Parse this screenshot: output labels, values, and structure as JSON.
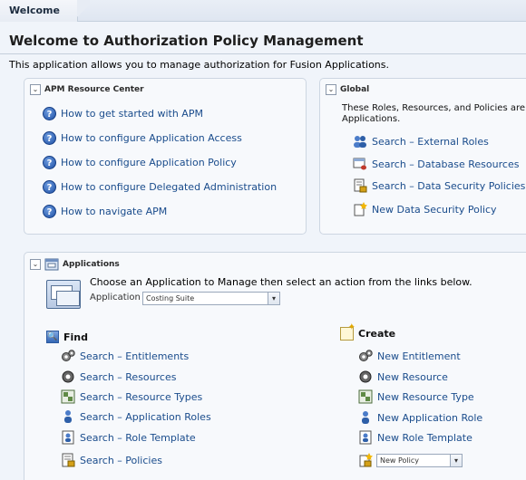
{
  "tab": {
    "label": "Welcome"
  },
  "page": {
    "title": "Welcome to Authorization Policy Management",
    "intro": "This application allows you to manage authorization for Fusion Applications."
  },
  "resource_center": {
    "title": "APM Resource Center",
    "links": [
      "How to get started with APM",
      "How to configure Application Access",
      "How to configure Application Policy",
      "How to configure Delegated Administration",
      "How to navigate APM"
    ]
  },
  "global": {
    "title": "Global",
    "description_line1": "These Roles, Resources, and Policies are s",
    "description_line2": "Applications.",
    "links": [
      {
        "label": "Search – External Roles",
        "icon": "external-roles-icon"
      },
      {
        "label": "Search – Database Resources",
        "icon": "database-resources-icon"
      },
      {
        "label": "Search – Data Security Policies",
        "icon": "data-security-policies-icon"
      },
      {
        "label": "New Data Security Policy",
        "icon": "new-data-security-policy-icon"
      }
    ]
  },
  "applications": {
    "title": "Applications",
    "choose_text": "Choose an Application to Manage then select an action from the links below.",
    "application_label": "Application",
    "application_value": "Costing Suite",
    "find": {
      "title": "Find",
      "links": [
        {
          "label": "Search – Entitlements",
          "icon": "entitlements-icon"
        },
        {
          "label": "Search – Resources",
          "icon": "resources-icon"
        },
        {
          "label": "Search – Resource Types",
          "icon": "resource-types-icon"
        },
        {
          "label": "Search – Application Roles",
          "icon": "application-roles-icon"
        },
        {
          "label": "Search – Role Template",
          "icon": "role-template-icon"
        },
        {
          "label": "Search – Policies",
          "icon": "policies-icon"
        }
      ]
    },
    "create": {
      "title": "Create",
      "links": [
        {
          "label": "New Entitlement",
          "icon": "entitlement-icon"
        },
        {
          "label": "New Resource",
          "icon": "resource-icon"
        },
        {
          "label": "New Resource Type",
          "icon": "resource-type-icon"
        },
        {
          "label": "New Application Role",
          "icon": "application-role-icon"
        },
        {
          "label": "New Role Template",
          "icon": "role-template-icon"
        }
      ],
      "policy_select_value": "New Policy"
    }
  },
  "colors": {
    "link": "#1a4c8c",
    "panel_bg": "#f7f9fc",
    "page_bg": "#f0f4fa"
  }
}
